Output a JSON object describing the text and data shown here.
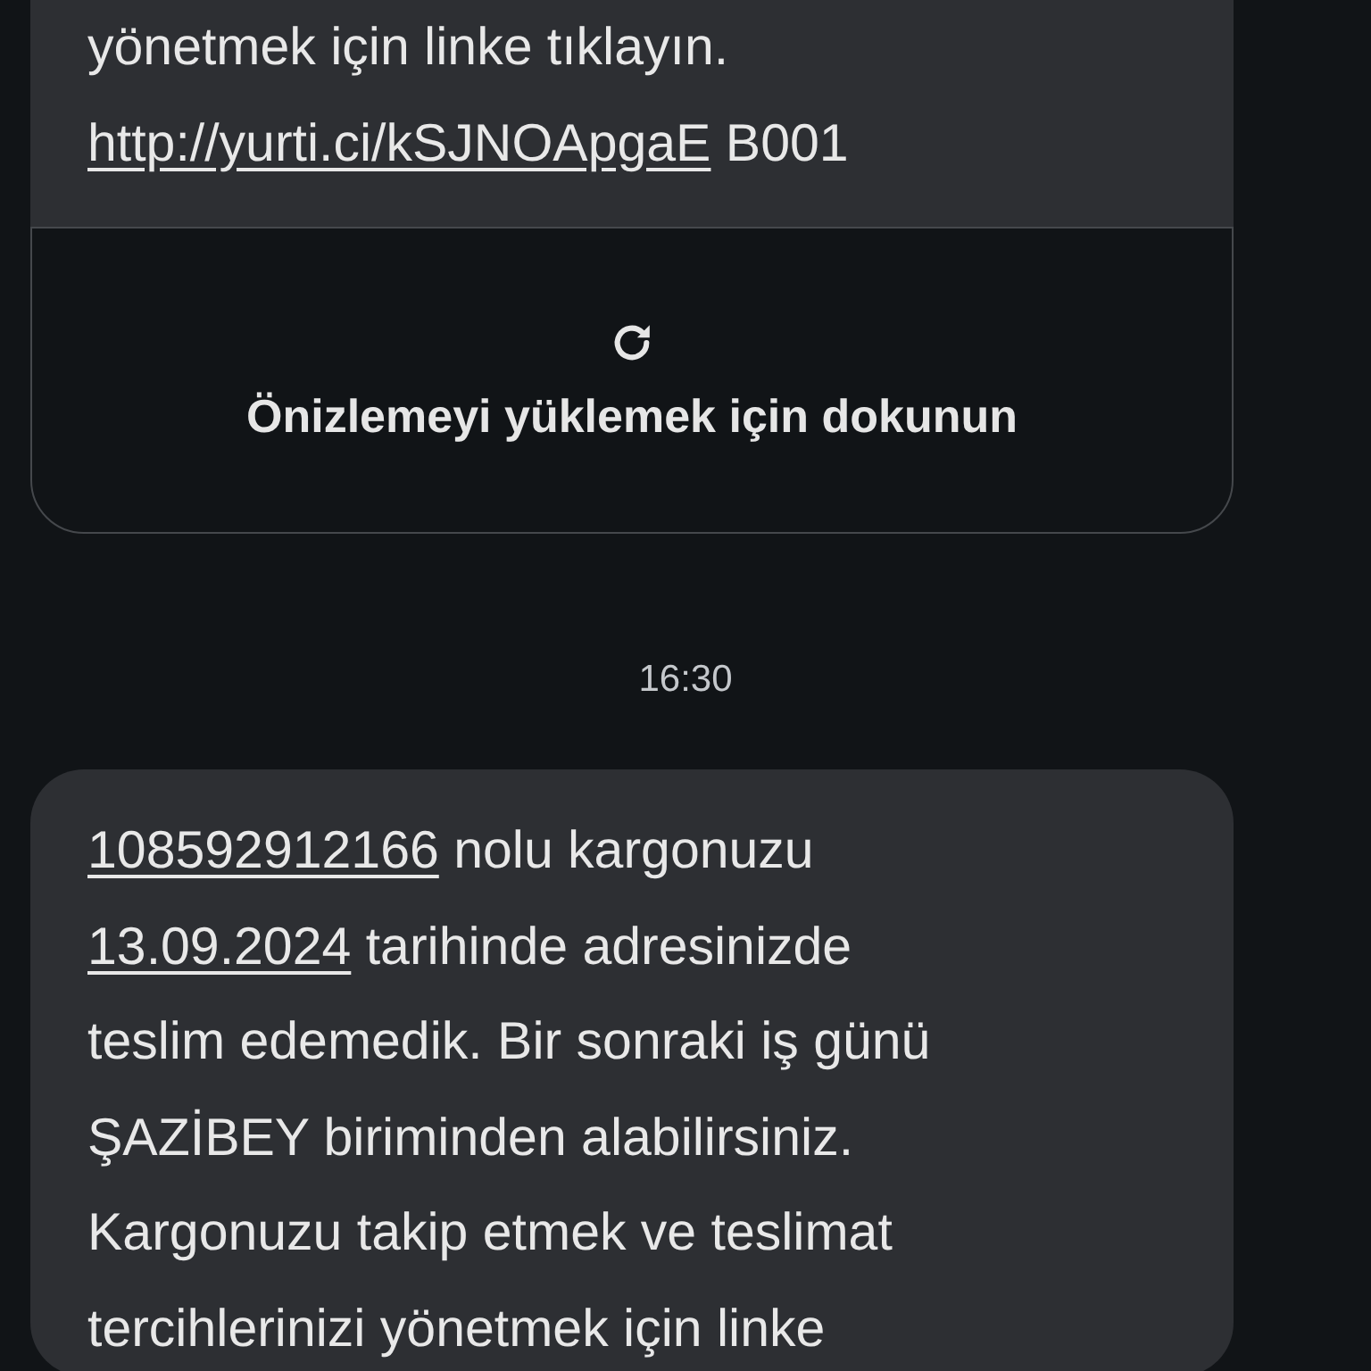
{
  "messages": [
    {
      "lines": [
        [
          {
            "text": "yönetmek için linke tıklayın."
          }
        ],
        [
          {
            "text": "http://yurti.ci/kSJNOApgaE",
            "link": true
          },
          {
            "text": " B001"
          }
        ]
      ],
      "preview": {
        "label": "Önizlemeyi yüklemek için dokunun"
      }
    },
    {
      "timestamp": "16:30",
      "lines": [
        [
          {
            "text": "108592912166",
            "link": true
          },
          {
            "text": " nolu kargonuzu"
          }
        ],
        [
          {
            "text": "13.09.2024",
            "link": true
          },
          {
            "text": " tarihinde adresinizde"
          }
        ],
        [
          {
            "text": "teslim edemedik. Bir sonraki iş günü"
          }
        ],
        [
          {
            "text": "ŞAZİBEY biriminden alabilirsiniz."
          }
        ],
        [
          {
            "text": "Kargonuzu takip etmek ve teslimat"
          }
        ],
        [
          {
            "text": "tercihlerinizi yönetmek için linke"
          }
        ]
      ]
    }
  ]
}
